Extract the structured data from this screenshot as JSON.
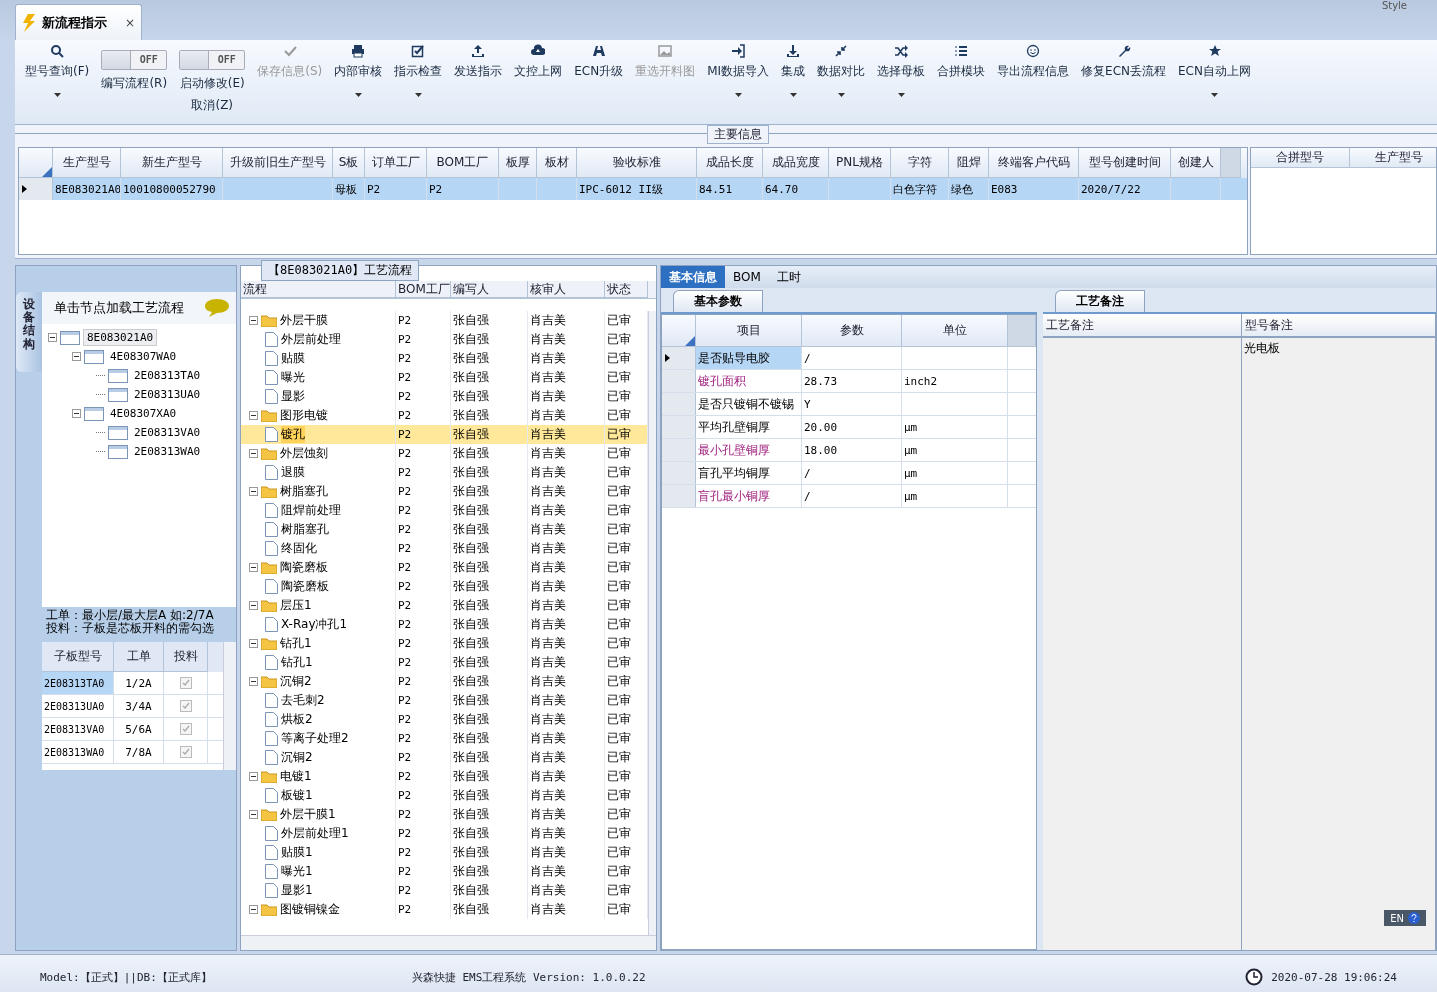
{
  "window": {
    "tab": {
      "title": "新流程指示",
      "close": "×",
      "selected": true
    },
    "style_menu": "Style"
  },
  "toolbar": [
    {
      "kind": "button",
      "label": "型号查询(F)",
      "dropdown": true,
      "disabled": false
    },
    {
      "kind": "toggle",
      "switch_text": "OFF",
      "on": false,
      "label": "编写流程(R)"
    },
    {
      "kind": "toggle",
      "switch_text": "OFF",
      "on": false,
      "label": "启动修改(E)",
      "second_label": "取消(Z)"
    },
    {
      "kind": "button",
      "label": "保存信息(S)",
      "dropdown": false,
      "disabled": true
    },
    {
      "kind": "button",
      "label": "内部审核",
      "dropdown": true,
      "disabled": false
    },
    {
      "kind": "button",
      "label": "指示检查",
      "dropdown": true,
      "disabled": false
    },
    {
      "kind": "button",
      "label": "发送指示",
      "dropdown": false,
      "disabled": false
    },
    {
      "kind": "button",
      "label": "文控上网",
      "dropdown": false,
      "disabled": false
    },
    {
      "kind": "button",
      "label": "ECN升级",
      "dropdown": false,
      "disabled": false
    },
    {
      "kind": "button",
      "label": "重选开料图",
      "dropdown": false,
      "disabled": true
    },
    {
      "kind": "button",
      "label": "MI数据导入",
      "dropdown": true,
      "disabled": false
    },
    {
      "kind": "button",
      "label": "集成",
      "dropdown": true,
      "disabled": false
    },
    {
      "kind": "button",
      "label": "数据对比",
      "dropdown": true,
      "disabled": false
    },
    {
      "kind": "button",
      "label": "选择母板",
      "dropdown": true,
      "disabled": false
    },
    {
      "kind": "button",
      "label": "合拼模块",
      "dropdown": false,
      "disabled": false
    },
    {
      "kind": "button",
      "label": "导出流程信息",
      "dropdown": false,
      "disabled": false
    },
    {
      "kind": "button",
      "label": "修复ECN丢流程",
      "dropdown": false,
      "disabled": false
    },
    {
      "kind": "button",
      "label": "ECN自动上网",
      "dropdown": true,
      "disabled": false
    }
  ],
  "main_info": {
    "title": "主要信息",
    "columns": [
      "生产型号",
      "新生产型号",
      "升级前旧生产型号",
      "S板",
      "订单工厂",
      "BOM工厂",
      "板厚",
      "板材",
      "验收标准",
      "成品长度",
      "成品宽度",
      "PNL规格",
      "字符",
      "阻焊",
      "终端客户代码",
      "型号创建时间",
      "创建人"
    ],
    "rows": [
      {
        "selected": true,
        "cells": [
          "8E083021A0",
          "10010800052790",
          null,
          "母板",
          "P2",
          "P2",
          null,
          null,
          "IPC-6012 II级",
          "84.51",
          "64.70",
          null,
          "白色字符",
          "绿色",
          "E083",
          "2020/7/22",
          null
        ]
      }
    ],
    "side_columns": [
      "合拼型号",
      "生产型号"
    ]
  },
  "structure_panel": {
    "side_tab": "设备结构",
    "hint": "单击节点加载工艺流程",
    "tree": [
      {
        "label": "8E083021A0",
        "selected": true,
        "expanded": true,
        "children": [
          {
            "label": "4E08307WA0",
            "selected": false,
            "expanded": true,
            "children": [
              {
                "label": "2E08313TA0",
                "selected": false
              },
              {
                "label": "2E08313UA0",
                "selected": false
              }
            ]
          },
          {
            "label": "4E08307XA0",
            "selected": false,
            "expanded": true,
            "children": [
              {
                "label": "2E08313VA0",
                "selected": false
              },
              {
                "label": "2E08313WA0",
                "selected": false
              }
            ]
          }
        ]
      }
    ],
    "notes": [
      "工单：最小层/最大层A 如:2/7A",
      "投料：子板是芯板开料的需勾选"
    ],
    "columns": [
      "子板型号",
      "工单",
      "投料"
    ],
    "rows": [
      {
        "board": "2E08313TA0",
        "order": "1/2A",
        "checked": true,
        "selected": true
      },
      {
        "board": "2E08313UA0",
        "order": "3/4A",
        "checked": true,
        "selected": false
      },
      {
        "board": "2E08313VA0",
        "order": "5/6A",
        "checked": true,
        "selected": false
      },
      {
        "board": "2E08313WA0",
        "order": "7/8A",
        "checked": true,
        "selected": false
      }
    ]
  },
  "process_panel": {
    "title": "【8E083021A0】工艺流程",
    "columns": [
      "流程",
      "BOM工厂",
      "编写人",
      "核审人",
      "状态"
    ],
    "steps": [
      {
        "name": "外层干膜",
        "factory": "P2",
        "writer": "张自强",
        "reviewer": "肖吉美",
        "status": "已审",
        "selected": false,
        "expanded": true,
        "children": [
          {
            "name": "外层前处理",
            "factory": "P2",
            "writer": "张自强",
            "reviewer": "肖吉美",
            "status": "已审",
            "selected": false
          },
          {
            "name": "贴膜",
            "factory": "P2",
            "writer": "张自强",
            "reviewer": "肖吉美",
            "status": "已审",
            "selected": false
          },
          {
            "name": "曝光",
            "factory": "P2",
            "writer": "张自强",
            "reviewer": "肖吉美",
            "status": "已审",
            "selected": false
          },
          {
            "name": "显影",
            "factory": "P2",
            "writer": "张自强",
            "reviewer": "肖吉美",
            "status": "已审",
            "selected": false
          }
        ]
      },
      {
        "name": "图形电镀",
        "factory": "P2",
        "writer": "张自强",
        "reviewer": "肖吉美",
        "status": "已审",
        "selected": false,
        "expanded": true,
        "children": [
          {
            "name": "镀孔",
            "factory": "P2",
            "writer": "张自强",
            "reviewer": "肖吉美",
            "status": "已审",
            "selected": true
          }
        ]
      },
      {
        "name": "外层蚀刻",
        "factory": "P2",
        "writer": "张自强",
        "reviewer": "肖吉美",
        "status": "已审",
        "selected": false,
        "expanded": true,
        "children": [
          {
            "name": "退膜",
            "factory": "P2",
            "writer": "张自强",
            "reviewer": "肖吉美",
            "status": "已审",
            "selected": false
          }
        ]
      },
      {
        "name": "树脂塞孔",
        "factory": "P2",
        "writer": "张自强",
        "reviewer": "肖吉美",
        "status": "已审",
        "selected": false,
        "expanded": true,
        "children": [
          {
            "name": "阻焊前处理",
            "factory": "P2",
            "writer": "张自强",
            "reviewer": "肖吉美",
            "status": "已审",
            "selected": false
          },
          {
            "name": "树脂塞孔",
            "factory": "P2",
            "writer": "张自强",
            "reviewer": "肖吉美",
            "status": "已审",
            "selected": false
          },
          {
            "name": "终固化",
            "factory": "P2",
            "writer": "张自强",
            "reviewer": "肖吉美",
            "status": "已审",
            "selected": false
          }
        ]
      },
      {
        "name": "陶瓷磨板",
        "factory": "P2",
        "writer": "张自强",
        "reviewer": "肖吉美",
        "status": "已审",
        "selected": false,
        "expanded": true,
        "children": [
          {
            "name": "陶瓷磨板",
            "factory": "P2",
            "writer": "张自强",
            "reviewer": "肖吉美",
            "status": "已审",
            "selected": false
          }
        ]
      },
      {
        "name": "层压1",
        "factory": "P2",
        "writer": "张自强",
        "reviewer": "肖吉美",
        "status": "已审",
        "selected": false,
        "expanded": true,
        "children": [
          {
            "name": "X-Ray冲孔1",
            "factory": "P2",
            "writer": "张自强",
            "reviewer": "肖吉美",
            "status": "已审",
            "selected": false
          }
        ]
      },
      {
        "name": "钻孔1",
        "factory": "P2",
        "writer": "张自强",
        "reviewer": "肖吉美",
        "status": "已审",
        "selected": false,
        "expanded": true,
        "children": [
          {
            "name": "钻孔1",
            "factory": "P2",
            "writer": "张自强",
            "reviewer": "肖吉美",
            "status": "已审",
            "selected": false
          }
        ]
      },
      {
        "name": "沉铜2",
        "factory": "P2",
        "writer": "张自强",
        "reviewer": "肖吉美",
        "status": "已审",
        "selected": false,
        "expanded": true,
        "children": [
          {
            "name": "去毛刺2",
            "factory": "P2",
            "writer": "张自强",
            "reviewer": "肖吉美",
            "status": "已审",
            "selected": false
          },
          {
            "name": "烘板2",
            "factory": "P2",
            "writer": "张自强",
            "reviewer": "肖吉美",
            "status": "已审",
            "selected": false
          },
          {
            "name": "等离子处理2",
            "factory": "P2",
            "writer": "张自强",
            "reviewer": "肖吉美",
            "status": "已审",
            "selected": false
          },
          {
            "name": "沉铜2",
            "factory": "P2",
            "writer": "张自强",
            "reviewer": "肖吉美",
            "status": "已审",
            "selected": false
          }
        ]
      },
      {
        "name": "电镀1",
        "factory": "P2",
        "writer": "张自强",
        "reviewer": "肖吉美",
        "status": "已审",
        "selected": false,
        "expanded": true,
        "children": [
          {
            "name": "板镀1",
            "factory": "P2",
            "writer": "张自强",
            "reviewer": "肖吉美",
            "status": "已审",
            "selected": false
          }
        ]
      },
      {
        "name": "外层干膜1",
        "factory": "P2",
        "writer": "张自强",
        "reviewer": "肖吉美",
        "status": "已审",
        "selected": false,
        "expanded": true,
        "children": [
          {
            "name": "外层前处理1",
            "factory": "P2",
            "writer": "张自强",
            "reviewer": "肖吉美",
            "status": "已审",
            "selected": false
          },
          {
            "name": "贴膜1",
            "factory": "P2",
            "writer": "张自强",
            "reviewer": "肖吉美",
            "status": "已审",
            "selected": false
          },
          {
            "name": "曝光1",
            "factory": "P2",
            "writer": "张自强",
            "reviewer": "肖吉美",
            "status": "已审",
            "selected": false
          },
          {
            "name": "显影1",
            "factory": "P2",
            "writer": "张自强",
            "reviewer": "肖吉美",
            "status": "已审",
            "selected": false
          }
        ]
      },
      {
        "name": "图镀铜镍金",
        "factory": "P2",
        "writer": "张自强",
        "reviewer": "肖吉美",
        "status": "已审",
        "selected": false,
        "expanded": true
      }
    ]
  },
  "detail_panel": {
    "tabs": [
      {
        "label": "基本信息",
        "selected": true
      },
      {
        "label": "BOM",
        "selected": false
      },
      {
        "label": "工时",
        "selected": false
      }
    ],
    "params_tab": "基本参数",
    "columns": [
      "项目",
      "参数",
      "单位"
    ],
    "params": [
      {
        "item": "是否贴导电胶",
        "value": "/",
        "required": false,
        "selected": true
      },
      {
        "item": "镀孔面积",
        "value": "28.73",
        "unit": "inch2",
        "required": true,
        "selected": false
      },
      {
        "item": "是否只镀铜不镀锡",
        "value": "Y",
        "required": false,
        "selected": false
      },
      {
        "item": "平均孔壁铜厚",
        "value": "20.00",
        "unit": "μm",
        "required": false,
        "selected": false
      },
      {
        "item": "最小孔壁铜厚",
        "value": "18.00",
        "unit": "μm",
        "required": true,
        "selected": false
      },
      {
        "item": "盲孔平均铜厚",
        "value": "/",
        "unit": "μm",
        "required": false,
        "selected": false
      },
      {
        "item": "盲孔最小铜厚",
        "value": "/",
        "unit": "μm",
        "required": true,
        "selected": false
      }
    ],
    "notes_tab": "工艺备注",
    "notes_columns": [
      "工艺备注",
      "型号备注"
    ],
    "model_note": "光电板",
    "ime": "EN"
  },
  "status_bar": {
    "left": "Model:【正式】||DB:【正式库】",
    "center": "兴森快捷 EMS工程系统 Version: 1.0.0.22",
    "time": "2020-07-28 19:06:24"
  }
}
